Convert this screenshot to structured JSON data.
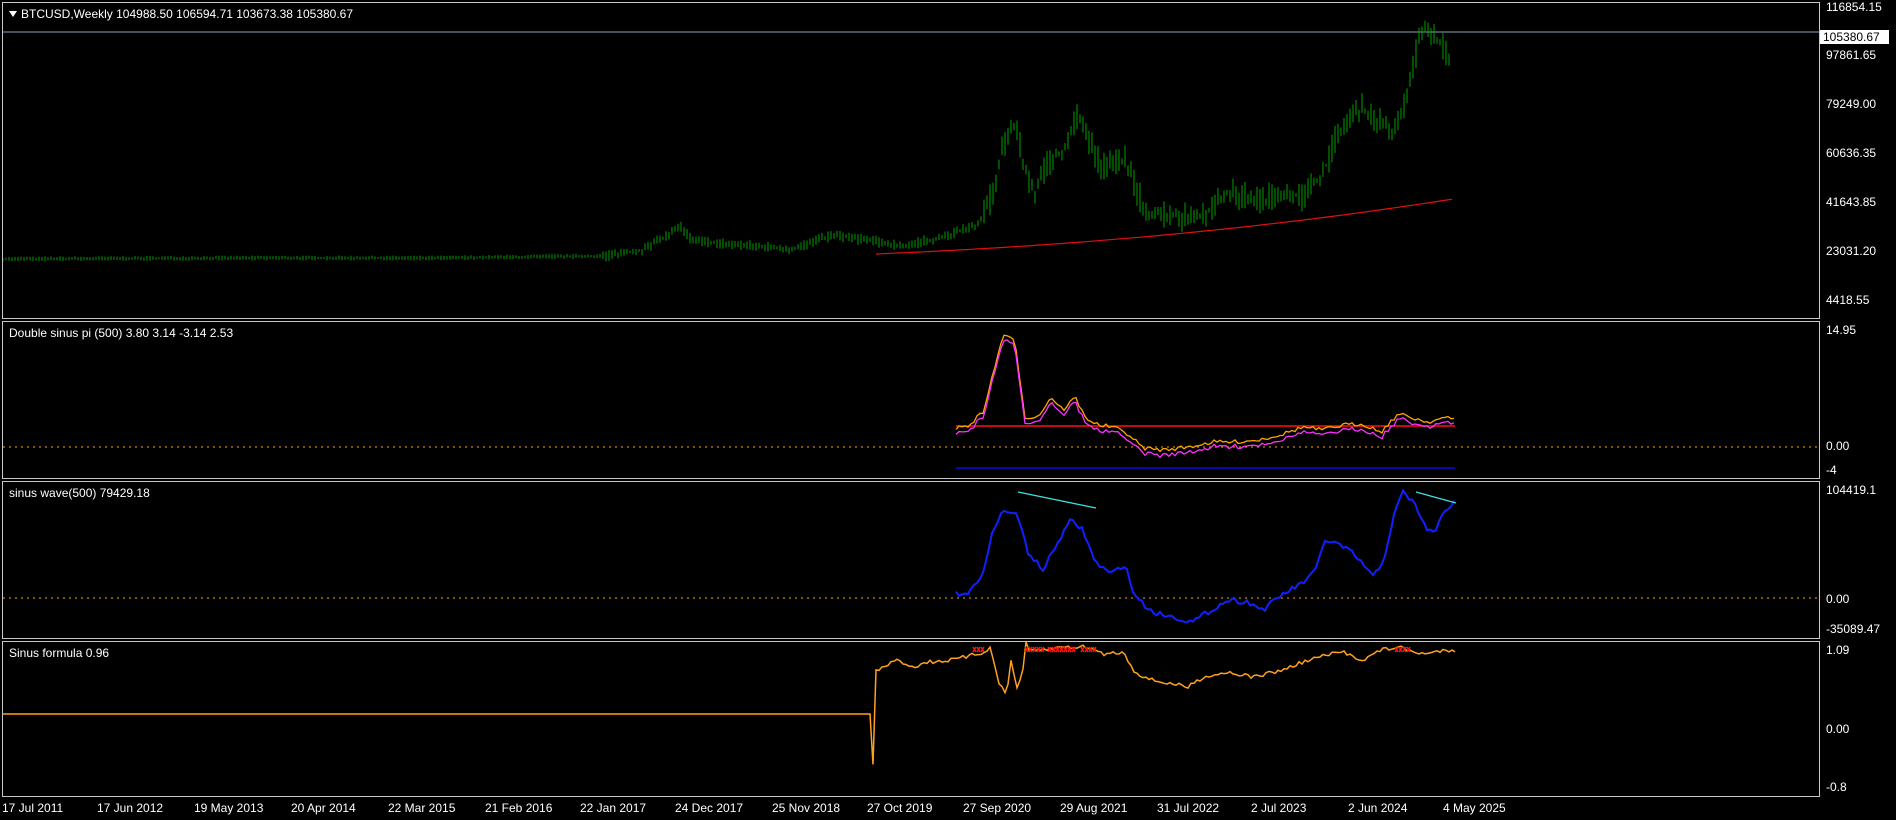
{
  "symbol_title": "BTCUSD,Weekly  104988.50 106594.71 103673.38 105380.67",
  "current_price": "105380.67",
  "panes": [
    {
      "title": "Double sinus pi (500) 3.80 3.14 -3.14 2.53",
      "labels": [
        "14.95",
        "0.00",
        "-4"
      ]
    },
    {
      "title": "sinus wave(500) 79429.18",
      "labels": [
        "104419.1",
        "0.00",
        "-35089.47"
      ]
    },
    {
      "title": "Sinus formula 0.96",
      "labels": [
        "1.09",
        "0.00",
        "-0.8"
      ]
    }
  ],
  "price_axis": [
    "116854.15",
    "97861.65",
    "79249.00",
    "60636.35",
    "41643.85",
    "23031.20",
    "4418.55"
  ],
  "date_axis": [
    "17 Jul 2011",
    "17 Jun 2012",
    "19 May 2013",
    "20 Apr 2014",
    "22 Mar 2015",
    "21 Feb 2016",
    "22 Jan 2017",
    "24 Dec 2017",
    "25 Nov 2018",
    "27 Oct 2019",
    "27 Sep 2020",
    "29 Aug 2021",
    "31 Jul 2022",
    "2 Jul 2023",
    "2 Jun 2024",
    "4 May 2025"
  ],
  "colors": {
    "candles": "#00a000",
    "ma": "#e01010",
    "upper": "#ffa500",
    "lower": "#ff30ff",
    "red_level": "#ff1010",
    "blue_level": "#0010e0",
    "wave": "#1020ff",
    "wave_trend": "#40e0e0",
    "formula": "#ffa020",
    "zero_dots": "#ffa500",
    "marks": "#ff1010"
  },
  "icons": [
    "collapse-triangle-icon"
  ]
}
